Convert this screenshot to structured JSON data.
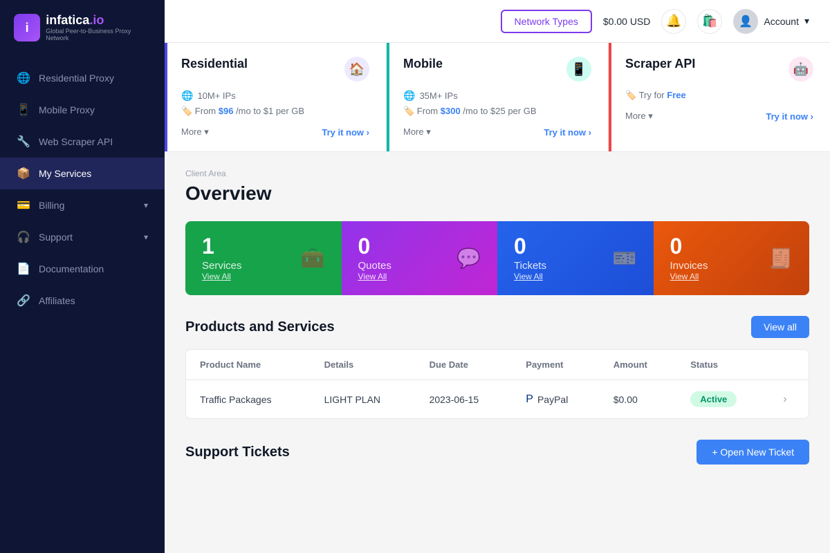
{
  "sidebar": {
    "logo": {
      "name": "infatica",
      "domain": ".io",
      "subtitle": "Global Peer-to-Business Proxy Network",
      "icon_text": "i"
    },
    "nav_items": [
      {
        "id": "residential-proxy",
        "label": "Residential Proxy",
        "icon": "🌐",
        "active": false,
        "has_chevron": false
      },
      {
        "id": "mobile-proxy",
        "label": "Mobile Proxy",
        "icon": "📱",
        "active": false,
        "has_chevron": false
      },
      {
        "id": "web-scraper-api",
        "label": "Web Scraper API",
        "icon": "🔧",
        "active": false,
        "has_chevron": false
      },
      {
        "id": "my-services",
        "label": "My Services",
        "icon": "📦",
        "active": true,
        "has_chevron": false
      },
      {
        "id": "billing",
        "label": "Billing",
        "icon": "💳",
        "active": false,
        "has_chevron": true
      },
      {
        "id": "support",
        "label": "Support",
        "icon": "🎧",
        "active": false,
        "has_chevron": true
      },
      {
        "id": "documentation",
        "label": "Documentation",
        "icon": "📄",
        "active": false,
        "has_chevron": false
      },
      {
        "id": "affiliates",
        "label": "Affiliates",
        "icon": "🔗",
        "active": false,
        "has_chevron": false
      }
    ]
  },
  "header": {
    "network_types_label": "Network Types",
    "balance": "$0.00 USD",
    "account_label": "Account"
  },
  "banner_cards": [
    {
      "id": "residential",
      "title": "Residential",
      "accent_class": "accent-blue",
      "icon_class": "icon-purple-bg",
      "icon": "🏠",
      "ips": "10M+ IPs",
      "price_text": "From ",
      "price_value": "$96",
      "price_suffix": " /mo to $1 per GB",
      "more_label": "More",
      "try_label": "Try it now"
    },
    {
      "id": "mobile",
      "title": "Mobile",
      "accent_class": "accent-teal",
      "icon_class": "icon-teal-bg",
      "icon": "📱",
      "ips": "35M+ IPs",
      "price_text": "From ",
      "price_value": "$300",
      "price_suffix": " /mo to $25 per GB",
      "more_label": "More",
      "try_label": "Try it now"
    },
    {
      "id": "scraper-api",
      "title": "Scraper API",
      "accent_class": "accent-red",
      "icon_class": "icon-pink-bg",
      "icon": "🤖",
      "ips": null,
      "price_text": "Try for ",
      "price_value": "Free",
      "price_suffix": "",
      "more_label": "More",
      "try_label": "Try it now"
    }
  ],
  "breadcrumb": "Client Area",
  "page_title": "Overview",
  "stats": [
    {
      "id": "services",
      "number": "1",
      "label": "Services",
      "view_all": "View All",
      "icon": "🧰",
      "card_class": "stat-card-green"
    },
    {
      "id": "quotes",
      "number": "0",
      "label": "Quotes",
      "view_all": "View All",
      "icon": "💬",
      "card_class": "stat-card-purple"
    },
    {
      "id": "tickets",
      "number": "0",
      "label": "Tickets",
      "view_all": "View All",
      "icon": "🎫",
      "card_class": "stat-card-blue"
    },
    {
      "id": "invoices",
      "number": "0",
      "label": "Invoices",
      "view_all": "View All",
      "icon": "🧾",
      "card_class": "stat-card-orange"
    }
  ],
  "products_section": {
    "title": "Products and Services",
    "view_all_label": "View all",
    "table_headers": [
      "Product Name",
      "Details",
      "Due Date",
      "Payment",
      "Amount",
      "Status"
    ],
    "rows": [
      {
        "product_name": "Traffic Packages",
        "details": "LIGHT PLAN",
        "due_date": "2023-06-15",
        "payment": "PayPal",
        "amount": "$0.00",
        "status": "Active"
      }
    ]
  },
  "support_section": {
    "title": "Support Tickets",
    "open_ticket_label": "+ Open New Ticket"
  }
}
